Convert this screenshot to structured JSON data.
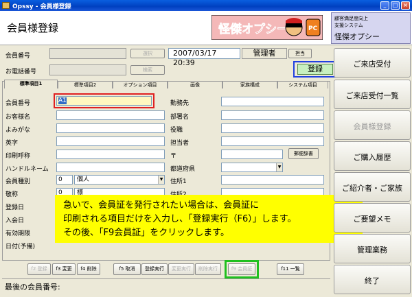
{
  "window": {
    "title": "Opssy - 会員様登録",
    "minimize": "_",
    "maximize": "□",
    "close": "×"
  },
  "header": {
    "page_title": "会員様登録",
    "logo_text": "怪傑オプシー",
    "logo_pc": "PC",
    "system_line1": "顧客満足度向上",
    "system_line2": "支援システム",
    "system_name": "怪傑オプシー"
  },
  "top": {
    "member_no_label": "会員番号",
    "phone_label": "お電話番号",
    "select_btn": "選択",
    "search_btn": "検索",
    "datetime": "2007/03/17 20:39",
    "user": "管理者",
    "assign_btn": "担当",
    "register_label": "登録"
  },
  "tabs": [
    "標準項目1",
    "標準項目2",
    "オプション項目",
    "画像",
    "家族構成",
    "システム項目"
  ],
  "form_left": {
    "member_no": "会員番号",
    "member_no_value": "A1",
    "name": "お客様名",
    "kana": "よみがな",
    "english": "英字",
    "print_name": "印刷呼称",
    "handle": "ハンドルネーム",
    "member_type": "会員種別",
    "member_type_code": "0",
    "member_type_value": "個人",
    "honorific": "敬称",
    "honorific_code": "0",
    "honorific_value": "様",
    "reg_date": "登録日",
    "join_date": "入会日",
    "expiry": "有効期限",
    "date_label": "日付(予備)"
  },
  "form_right": {
    "workplace": "勤務先",
    "department": "部署名",
    "position": "役職",
    "person": "担当者",
    "postal": "〒",
    "postal_btn": "郵便辞書",
    "prefecture": "都道府県",
    "addr1": "住所1",
    "addr2": "住所2"
  },
  "right_buttons": [
    "ご来店受付",
    "ご来店受付一覧",
    "会員様登録",
    "ご購入履歴",
    "ご紹介者・ご家族",
    "ご要望メモ",
    "管理業務",
    "終了"
  ],
  "fkeys": [
    "f2 登録",
    "f3 変更",
    "f4 削除",
    "f5 取消",
    "登録実行",
    "変更実行",
    "削除実行",
    "f9 会員証",
    "f11 一覧"
  ],
  "status": {
    "last_member": "最後の会員番号:"
  },
  "note": {
    "line1": "急いで、会員証を発行されたい場合は、会員証に",
    "line2": "印刷される項目だけを入力し、「登録実行（F6）」します。",
    "line3": "その後、「F9会員証」をクリックします。"
  },
  "colors": {
    "highlight_red": "#e02020",
    "highlight_blue": "#2040e0",
    "highlight_green": "#20c020",
    "note_bg": "#ffff00"
  }
}
